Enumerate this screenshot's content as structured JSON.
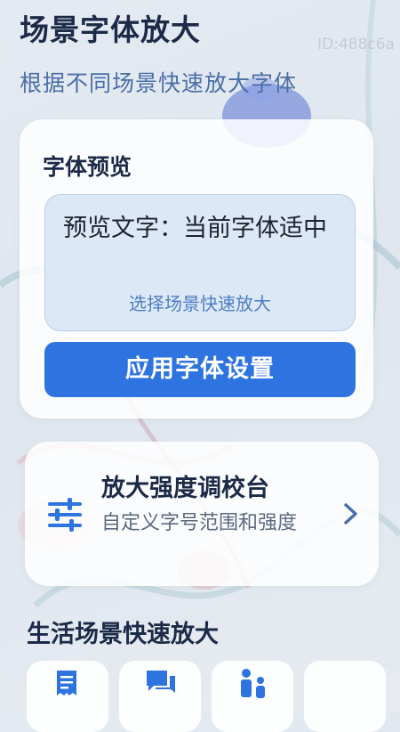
{
  "header": {
    "title": "场景字体放大",
    "subtitle": "根据不同场景快速放大字体",
    "page_id": "ID:488c6a"
  },
  "preview": {
    "title": "字体预览",
    "sample_text": "预览文字：当前字体适中",
    "hint": "选择场景快速放大",
    "apply_label": "应用字体设置"
  },
  "tuning": {
    "icon": "sliders-icon",
    "title": "放大强度调校台",
    "description": "自定义字号范围和强度",
    "chevron": "chevron-right-icon"
  },
  "scenes": {
    "title": "生活场景快速放大",
    "tiles": [
      {
        "icon": "receipt-icon"
      },
      {
        "icon": "chat-icon"
      },
      {
        "icon": "family-icon"
      },
      {
        "icon": "blank"
      }
    ]
  },
  "colors": {
    "primary": "#2e74e0",
    "title_text": "#1c2a48",
    "subtitle_text": "#4a6ea6",
    "preview_bg": "#dce8f6"
  }
}
